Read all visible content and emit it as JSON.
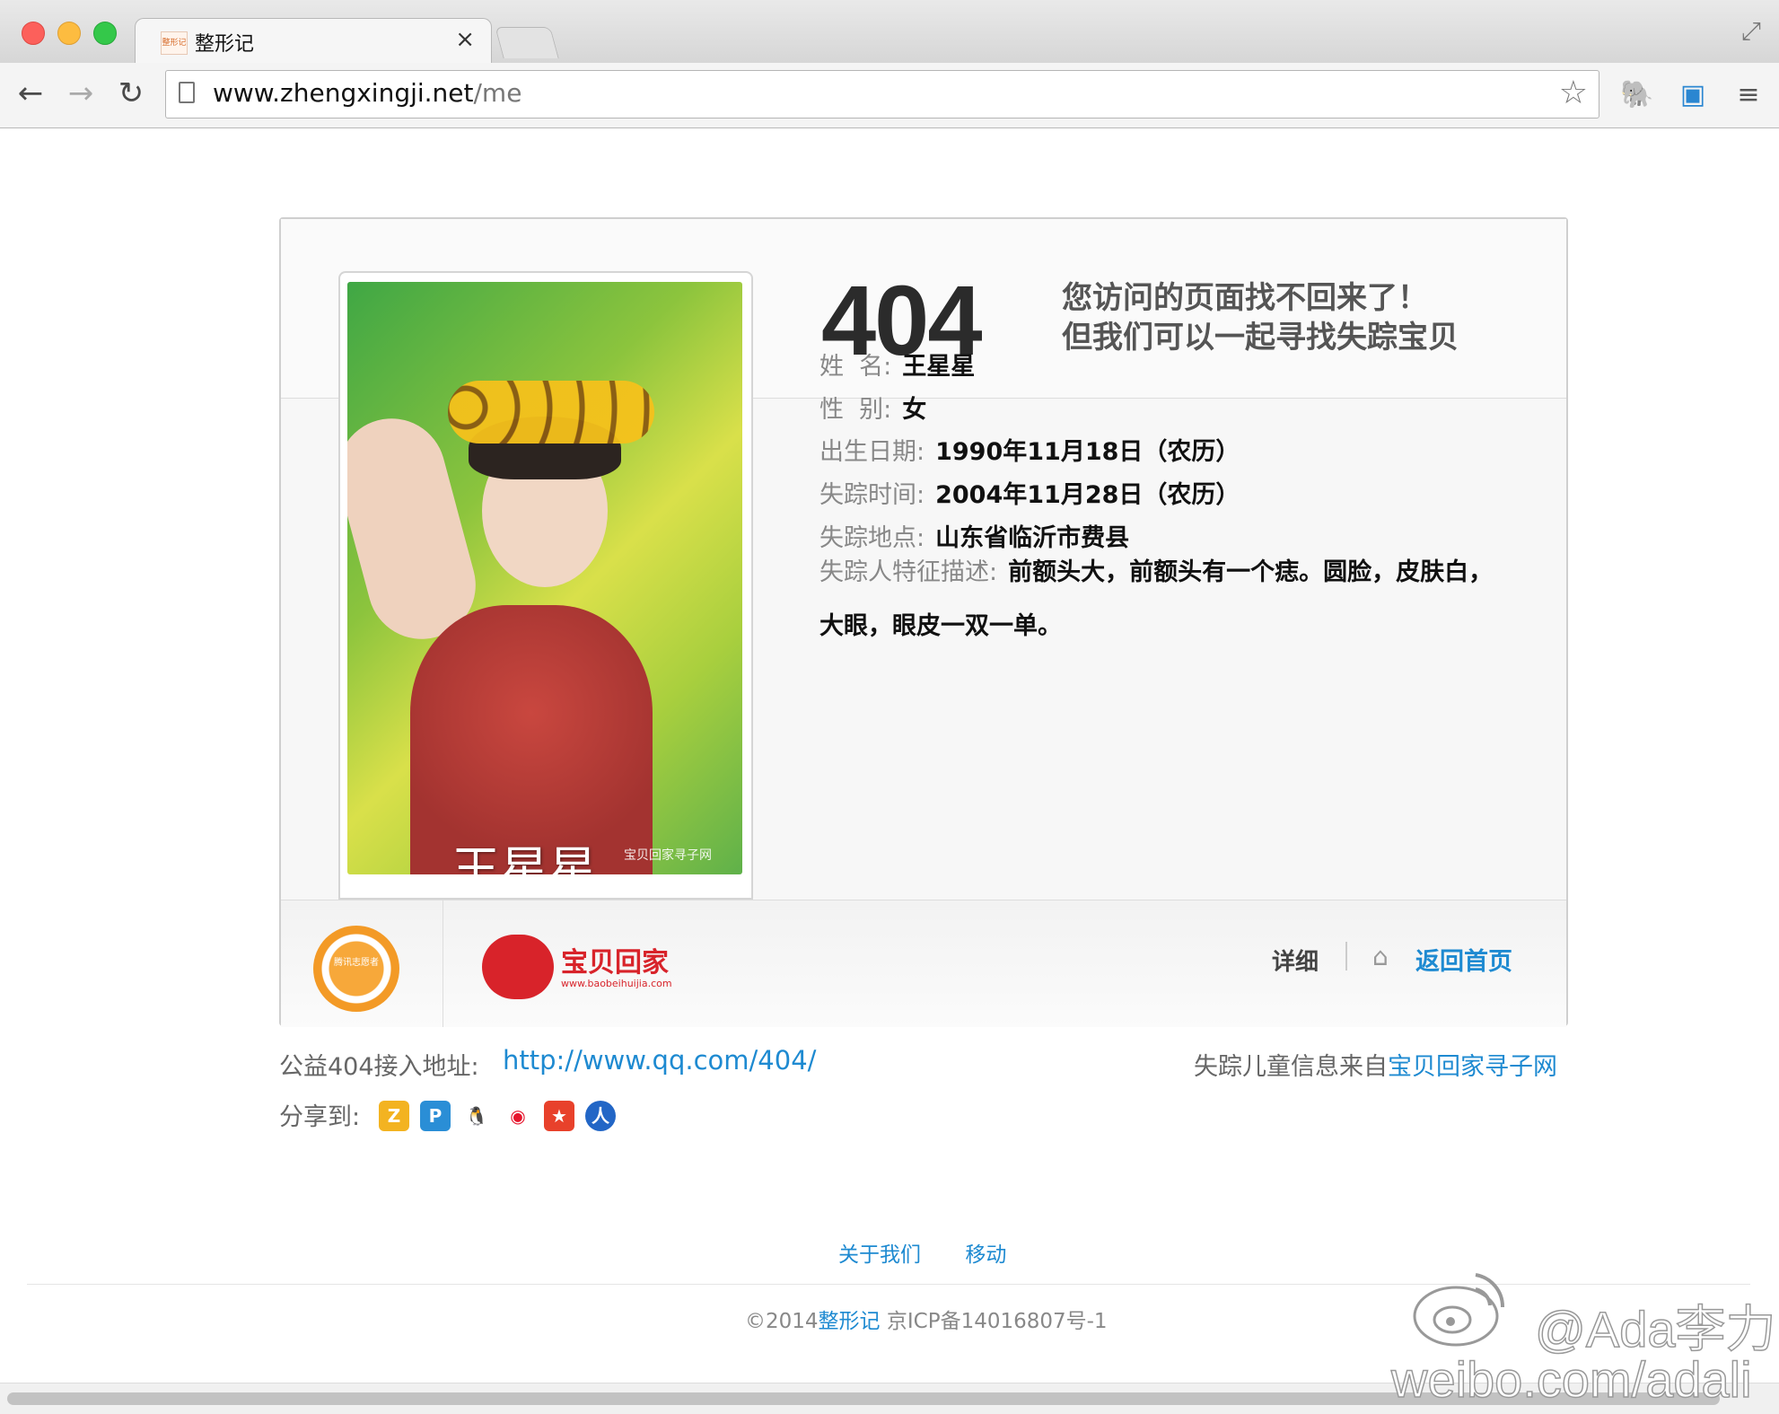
{
  "browser": {
    "tab_title": "整形记",
    "tab_favicon_text": "整形记",
    "url_host": "www.zhengxingji.net",
    "url_path": "/me",
    "colors": {
      "close": "#fc605b",
      "minimize": "#fdbc40",
      "maximize": "#34c84a"
    }
  },
  "card": {
    "code": "404",
    "line1": "您访问的页面找不回来了！",
    "line2": "但我们可以一起寻找失踪宝贝",
    "photo_caption": "王星星",
    "photo_watermark": "宝贝回家寻子网",
    "fields": [
      {
        "label": "姓  名:",
        "value": "王星星"
      },
      {
        "label": "性  别:",
        "value": "女"
      },
      {
        "label": "出生日期:",
        "value": "1990年11月18日（农历）"
      },
      {
        "label": "失踪时间:",
        "value": "2004年11月28日（农历）"
      },
      {
        "label": "失踪地点:",
        "value": "山东省临沂市费县"
      }
    ],
    "desc_label": "失踪人特征描述:",
    "desc_value": "前额头大，前额头有一个痣。圆脸，皮肤白，大眼，眼皮一双一单。",
    "qq_badge_text": "腾讯志愿者",
    "bb_logo_text": "宝贝回家",
    "bb_logo_url": "www.baobeihuijia.com",
    "detail_label": "详细",
    "home_label": "返回首页"
  },
  "below": {
    "addr_label": "公益404接入地址:",
    "addr_link": "http://www.qq.com/404/",
    "source_prefix": "失踪儿童信息来自",
    "source_link": "宝贝回家寻子网",
    "share_label": "分享到:",
    "share_icons": [
      "qzone-icon",
      "tencent-pengyou-icon",
      "qq-icon",
      "weibo-icon",
      "kaixin-icon",
      "renren-icon"
    ]
  },
  "footer": {
    "links": [
      "关于我们",
      "移动"
    ],
    "copyright_prefix": "©2014",
    "copyright_brand": "整形记",
    "copyright_suffix": " 京ICP备14016807号-1"
  },
  "watermark": {
    "handle": "@Ada李力",
    "url": "weibo.com/adali"
  }
}
